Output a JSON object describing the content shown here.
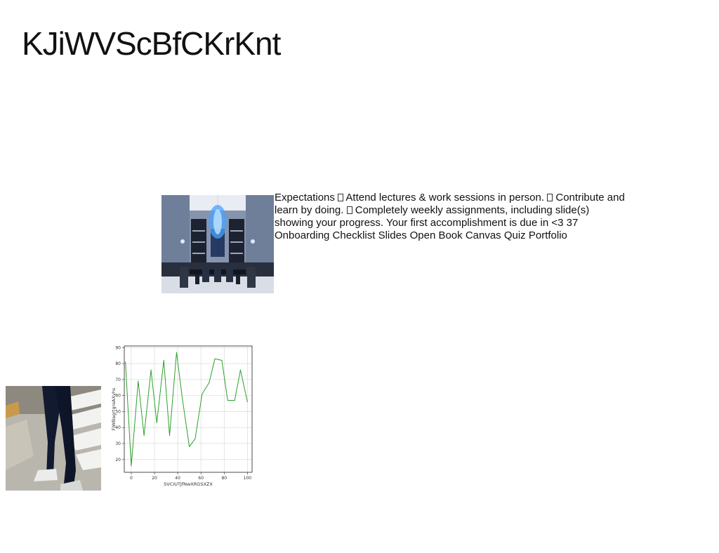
{
  "page": {
    "title": "KJiWVScBfCKrKnt"
  },
  "body_text": {
    "segments": [
      "Expectations ",
      " Attend lectures & work sessions in person. ",
      " Contribute and learn by doing. ",
      " Completely weekly assignments, including slide(s) showing your progress. Your first accomplishment is due in <3 37 Onboarding Checklist Slides Open Book Canvas Quiz Portfolio"
    ]
  },
  "images": {
    "dining": "dining-room-photo",
    "street": "pedestrian-crosswalk-photo"
  },
  "chart_data": {
    "type": "line",
    "xlabel": "SVCIUTJfNwXRGSXZX",
    "ylabel": "FJWBagrtgreAXyhs",
    "xlim": [
      -6,
      104
    ],
    "ylim": [
      12,
      91
    ],
    "xticks": [
      0,
      20,
      40,
      60,
      80,
      100
    ],
    "yticks": [
      20,
      30,
      40,
      50,
      60,
      70,
      80,
      90
    ],
    "grid": true,
    "series": [
      {
        "color": "#2ca02c",
        "x": [
          -5,
          0,
          6,
          11,
          17,
          22,
          28,
          33,
          39,
          44,
          50,
          55,
          61,
          67,
          72,
          78,
          83,
          89,
          94,
          100
        ],
        "y": [
          81,
          16,
          69,
          35,
          76,
          43,
          82,
          35,
          87,
          58,
          28,
          33,
          61,
          68,
          83,
          82,
          57,
          57,
          76,
          56
        ]
      }
    ]
  }
}
